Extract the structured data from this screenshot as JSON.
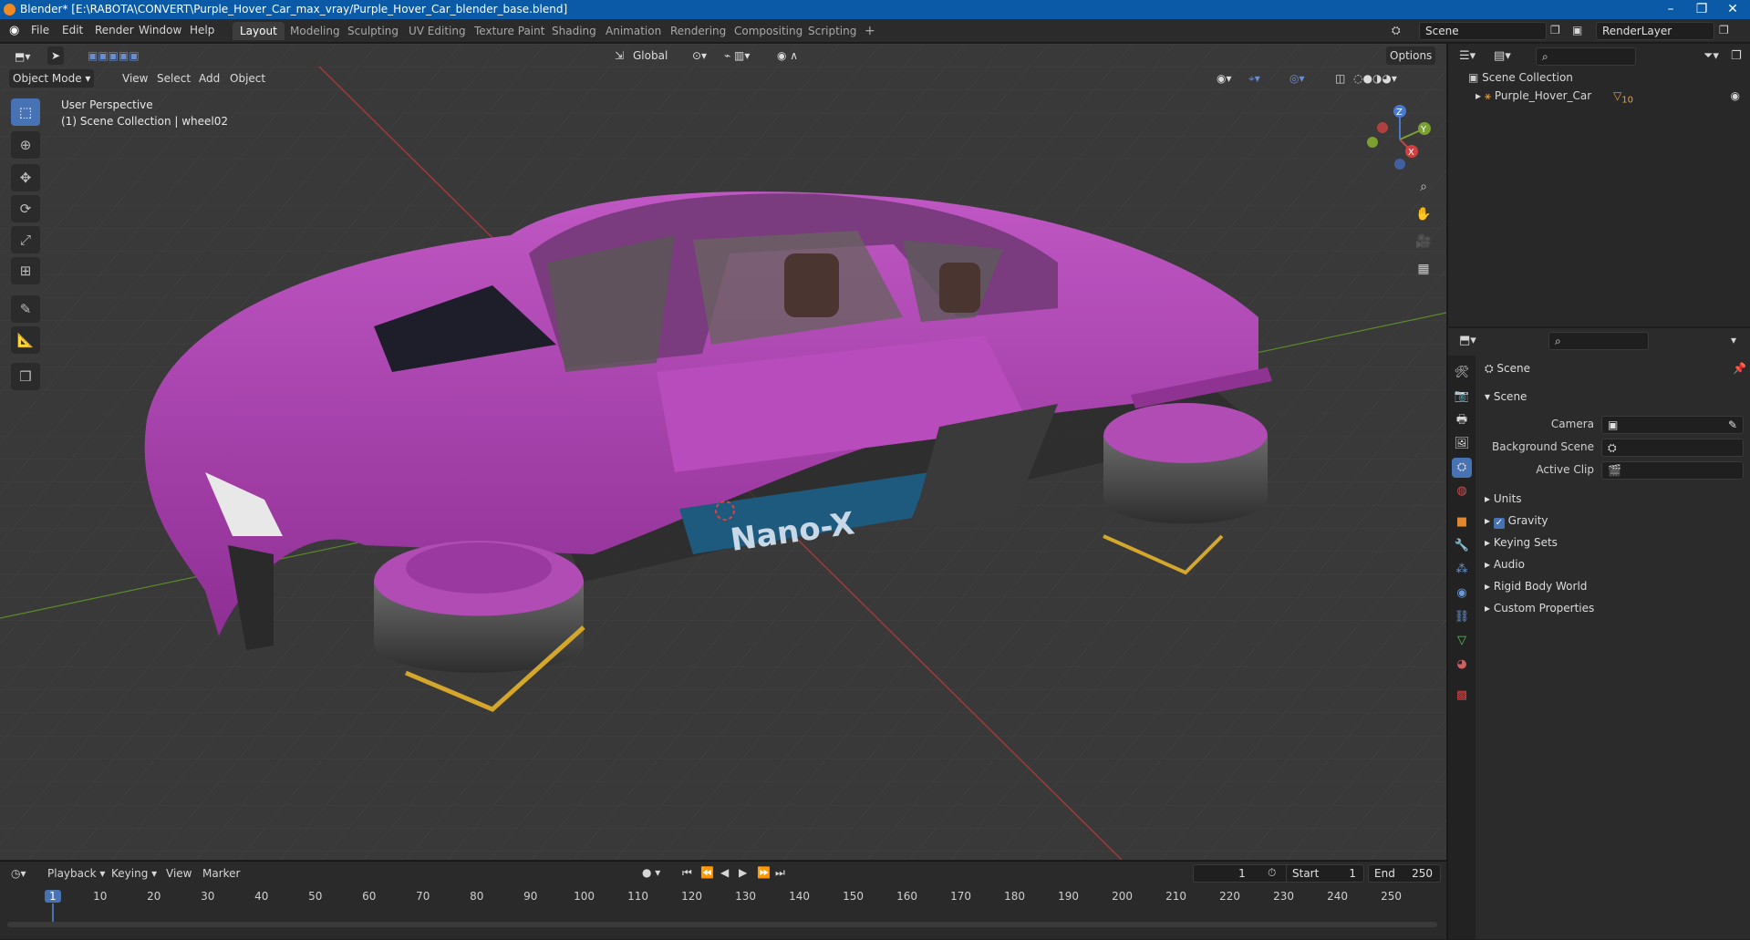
{
  "window": {
    "title": "Blender* [E:\\RABOTA\\CONVERT\\Purple_Hover_Car_max_vray/Purple_Hover_Car_blender_base.blend]"
  },
  "menu": [
    "File",
    "Edit",
    "Render",
    "Window",
    "Help"
  ],
  "workspaces": [
    "Layout",
    "Modeling",
    "Sculpting",
    "UV Editing",
    "Texture Paint",
    "Shading",
    "Animation",
    "Rendering",
    "Compositing",
    "Scripting"
  ],
  "active_workspace": "Layout",
  "scene_field": "Scene",
  "renderlayer_field": "RenderLayer",
  "viewport": {
    "mode": "Object Mode",
    "menus": [
      "View",
      "Select",
      "Add",
      "Object"
    ],
    "transform": "Global",
    "options": "Options",
    "perspective": "User Perspective",
    "collection_info": "(1) Scene Collection | wheel02",
    "car_text": "Nano-X"
  },
  "gizmo": {
    "x": "X",
    "y": "Y",
    "z": "Z"
  },
  "outliner": {
    "root": "Scene Collection",
    "items": [
      {
        "label": "Purple_Hover_Car",
        "badge": "10"
      }
    ]
  },
  "properties": {
    "header": "Scene",
    "panel": "Scene",
    "rows": [
      {
        "label": "Camera"
      },
      {
        "label": "Background Scene"
      },
      {
        "label": "Active Clip"
      }
    ],
    "sections": [
      "Units",
      "Gravity",
      "Keying Sets",
      "Audio",
      "Rigid Body World",
      "Custom Properties"
    ],
    "gravity_checked": true
  },
  "timeline": {
    "menus": [
      "Playback",
      "Keying",
      "View",
      "Marker"
    ],
    "current_frame": "1",
    "start_label": "Start",
    "start": "1",
    "end_label": "End",
    "end": "250",
    "ticks": [
      "1",
      "10",
      "20",
      "30",
      "40",
      "50",
      "60",
      "70",
      "80",
      "90",
      "100",
      "110",
      "120",
      "130",
      "140",
      "150",
      "160",
      "170",
      "180",
      "190",
      "200",
      "210",
      "220",
      "230",
      "240",
      "250"
    ]
  },
  "colors": {
    "accent": "#4772b3",
    "car": "#b23cb4",
    "titlebar": "#0a5aa8",
    "frame_marker": "#4772b3"
  }
}
